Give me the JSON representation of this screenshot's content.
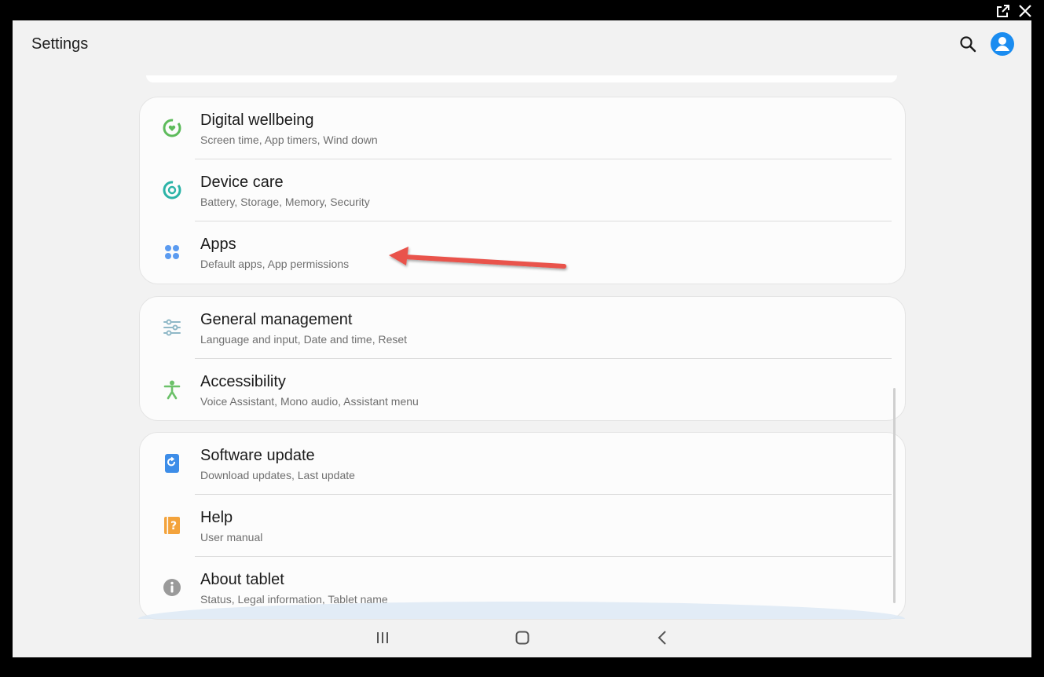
{
  "header": {
    "title": "Settings",
    "icons": [
      "search-icon",
      "profile-icon"
    ]
  },
  "window": {
    "icons": [
      "external-link-icon",
      "close-icon"
    ]
  },
  "groups": [
    {
      "items": [
        {
          "label": "Digital wellbeing",
          "sub": "Screen time, App timers, Wind down",
          "icon": "digital-wellbeing-icon",
          "color": "#5dbb5b"
        },
        {
          "label": "Device care",
          "sub": "Battery, Storage, Memory, Security",
          "icon": "device-care-icon",
          "color": "#2bb3a7"
        },
        {
          "label": "Apps",
          "sub": "Default apps, App permissions",
          "icon": "apps-icon",
          "color": "#5b9bf0"
        }
      ]
    },
    {
      "items": [
        {
          "label": "General management",
          "sub": "Language and input, Date and time, Reset",
          "icon": "general-management-icon",
          "color": "#8fb8c7"
        },
        {
          "label": "Accessibility",
          "sub": "Voice Assistant, Mono audio, Assistant menu",
          "icon": "accessibility-icon",
          "color": "#6cc16a"
        }
      ]
    },
    {
      "items": [
        {
          "label": "Software update",
          "sub": "Download updates, Last update",
          "icon": "software-update-icon",
          "color": "#3d8de8"
        },
        {
          "label": "Help",
          "sub": "User manual",
          "icon": "help-icon",
          "color": "#f3a33c"
        },
        {
          "label": "About tablet",
          "sub": "Status, Legal information, Tablet name",
          "icon": "info-icon",
          "color": "#9a9a9a"
        }
      ]
    }
  ],
  "navigation": {
    "icons": [
      "recents-icon",
      "home-icon",
      "back-icon"
    ]
  },
  "annotation": {
    "type": "arrow",
    "color": "#e9534b",
    "points_to": "Apps"
  }
}
